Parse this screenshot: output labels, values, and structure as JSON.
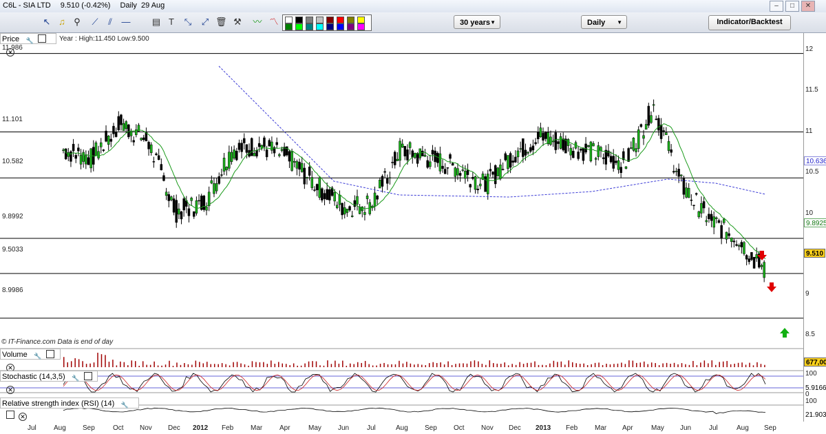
{
  "window": {
    "symbol": "C6L - SIA LTD",
    "price_change": "9.510 (-0.42%)",
    "period_date": "Daily  29 Aug"
  },
  "toolbar": {
    "range_select": "30 years",
    "interval_select": "Daily",
    "indicator_button": "Indicator/Backtest",
    "icons": [
      "pointer-icon",
      "alert-bell-icon",
      "zoom-icon",
      "trendline-icon",
      "parallel-lines-icon",
      "fan-icon",
      "horizontal-line-icon",
      "fibonacci-icon",
      "text-icon",
      "projection-icon",
      "arrows-icon",
      "trash-icon",
      "tools-icon",
      "wave-icon",
      "draw-tools-icon"
    ],
    "palette_colors": [
      "#ffffff",
      "#000000",
      "#808080",
      "#c0c0c0",
      "#800000",
      "#ff0000",
      "#808000",
      "#ffff00",
      "#008000",
      "#00ff00",
      "#008080",
      "#00ffff",
      "#000080",
      "#0000ff",
      "#800080",
      "#ff00ff"
    ]
  },
  "price_panel": {
    "title": "Price",
    "range_note": "Year : High:11.450 Low:9.500",
    "credit": "© IT-Finance.com  Data is end of day",
    "level_labels": [
      "11.986",
      "11.101",
      "10.582",
      "9.8992",
      "9.5033",
      "8.9986"
    ],
    "axis_ticks": [
      "12",
      "11.5",
      "11",
      "10.5",
      "10",
      "9.5",
      "9",
      "8.5"
    ],
    "tags": {
      "ma_long": "10.636",
      "ma_short": "9.8925",
      "last": "9.510"
    }
  },
  "volume_panel": {
    "title": "Volume",
    "value": "677,00"
  },
  "stochastic_panel": {
    "title": "Stochastic (14,3,5)",
    "axis_top": "100",
    "value": "5.9166",
    "axis_bottom": "0"
  },
  "rsi_panel": {
    "title": "Relative strength index (RSI) (14)",
    "axis_top": "100",
    "value": "21.903"
  },
  "x_axis": [
    {
      "label": "Jul",
      "bold": false
    },
    {
      "label": "Aug",
      "bold": false
    },
    {
      "label": "Sep",
      "bold": false
    },
    {
      "label": "Oct",
      "bold": false
    },
    {
      "label": "Nov",
      "bold": false
    },
    {
      "label": "Dec",
      "bold": false
    },
    {
      "label": "2012",
      "bold": true
    },
    {
      "label": "Feb",
      "bold": false
    },
    {
      "label": "Mar",
      "bold": false
    },
    {
      "label": "Apr",
      "bold": false
    },
    {
      "label": "May",
      "bold": false
    },
    {
      "label": "Jun",
      "bold": false
    },
    {
      "label": "Jul",
      "bold": false
    },
    {
      "label": "Aug",
      "bold": false
    },
    {
      "label": "Sep",
      "bold": false
    },
    {
      "label": "Oct",
      "bold": false
    },
    {
      "label": "Nov",
      "bold": false
    },
    {
      "label": "Dec",
      "bold": false
    },
    {
      "label": "2013",
      "bold": true
    },
    {
      "label": "Feb",
      "bold": false
    },
    {
      "label": "Mar",
      "bold": false
    },
    {
      "label": "Apr",
      "bold": false
    },
    {
      "label": "May",
      "bold": false
    },
    {
      "label": "Jun",
      "bold": false
    },
    {
      "label": "Jul",
      "bold": false
    },
    {
      "label": "Aug",
      "bold": false
    },
    {
      "label": "Sep",
      "bold": false
    }
  ],
  "chart_data": {
    "type": "candlestick",
    "title": "C6L - SIA LTD",
    "ylim": [
      8.5,
      12.1
    ],
    "y_ticks": [
      12,
      11.5,
      11,
      10.5,
      10,
      9.5,
      9,
      8.5
    ],
    "horizontal_levels": [
      11.986,
      11.101,
      10.582,
      9.8992,
      9.5033,
      8.9986
    ],
    "approx_close_path": [
      {
        "x": "Jul 2011",
        "y": null
      },
      {
        "x": "Aug 2011",
        "y": 10.9
      },
      {
        "x": "Sep 2011",
        "y": 10.8
      },
      {
        "x": "Oct 2011",
        "y": 11.2
      },
      {
        "x": "Nov 2011",
        "y": 11.0
      },
      {
        "x": "Dec 2011",
        "y": 10.2
      },
      {
        "x": "Jan 2012",
        "y": 10.3
      },
      {
        "x": "Feb 2012",
        "y": 10.9
      },
      {
        "x": "Mar 2012",
        "y": 10.95
      },
      {
        "x": "Apr 2012",
        "y": 10.8
      },
      {
        "x": "May 2012",
        "y": 10.5
      },
      {
        "x": "Jun 2012",
        "y": 10.25
      },
      {
        "x": "Jul 2012",
        "y": 10.3
      },
      {
        "x": "Aug 2012",
        "y": 10.9
      },
      {
        "x": "Sep 2012",
        "y": 10.8
      },
      {
        "x": "Oct 2012",
        "y": 10.7
      },
      {
        "x": "Nov 2012",
        "y": 10.5
      },
      {
        "x": "Dec 2012",
        "y": 10.85
      },
      {
        "x": "Jan 2013",
        "y": 11.05
      },
      {
        "x": "Feb 2013",
        "y": 10.95
      },
      {
        "x": "Mar 2013",
        "y": 10.85
      },
      {
        "x": "Apr 2013",
        "y": 10.75
      },
      {
        "x": "May 2013",
        "y": 11.4
      },
      {
        "x": "Jun 2013",
        "y": 10.5
      },
      {
        "x": "Jul 2013",
        "y": 10.1
      },
      {
        "x": "Aug 2013",
        "y": 9.9
      },
      {
        "x": "Sep 2013",
        "y": 9.51
      }
    ],
    "series": [
      {
        "name": "short MA",
        "color": "#1a9a1a",
        "last": 9.8925
      },
      {
        "name": "long MA",
        "color": "#3b3bd6",
        "last": 10.636
      }
    ],
    "signals": [
      {
        "type": "sell",
        "color": "#e00000"
      },
      {
        "type": "sell",
        "color": "#e00000"
      },
      {
        "type": "buy",
        "color": "#12b012"
      }
    ]
  }
}
